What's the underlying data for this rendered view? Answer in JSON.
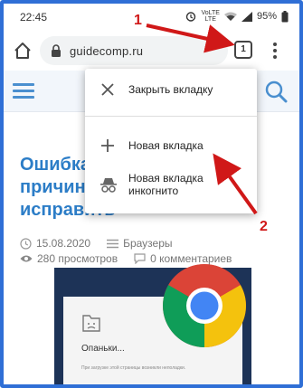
{
  "status_bar": {
    "time": "22:45",
    "network_top": "VoLTE",
    "network_bottom": "LTE",
    "battery": "95%"
  },
  "address_bar": {
    "url": "guidecomp.ru",
    "tab_count": "1"
  },
  "menu": {
    "items": [
      {
        "label": "Закрыть вкладку",
        "icon": "close-icon"
      },
      {
        "label": "Новая вкладка",
        "icon": "plus-icon"
      },
      {
        "label": "Новая вкладка инкогнито",
        "icon": "incognito-icon"
      }
    ]
  },
  "page": {
    "title_lines": [
      "Ошибка (",
      "причины",
      "исправить"
    ],
    "date": "15.08.2020",
    "category": "Браузеры",
    "views": "280 просмотров",
    "comments": "0 комментариев",
    "thumbnail": {
      "heading": "Опаньки...",
      "note": "При загрузке этой страницы возникли неполадки."
    }
  },
  "annotations": {
    "step1": "1",
    "step2": "2",
    "color": "#d01818"
  },
  "colors": {
    "frame": "#2f6fd6",
    "title": "#2c7dc7",
    "chrome_red": "#db4437",
    "chrome_yellow": "#f4c20d",
    "chrome_green": "#0f9d58",
    "chrome_blue": "#4285f4"
  }
}
